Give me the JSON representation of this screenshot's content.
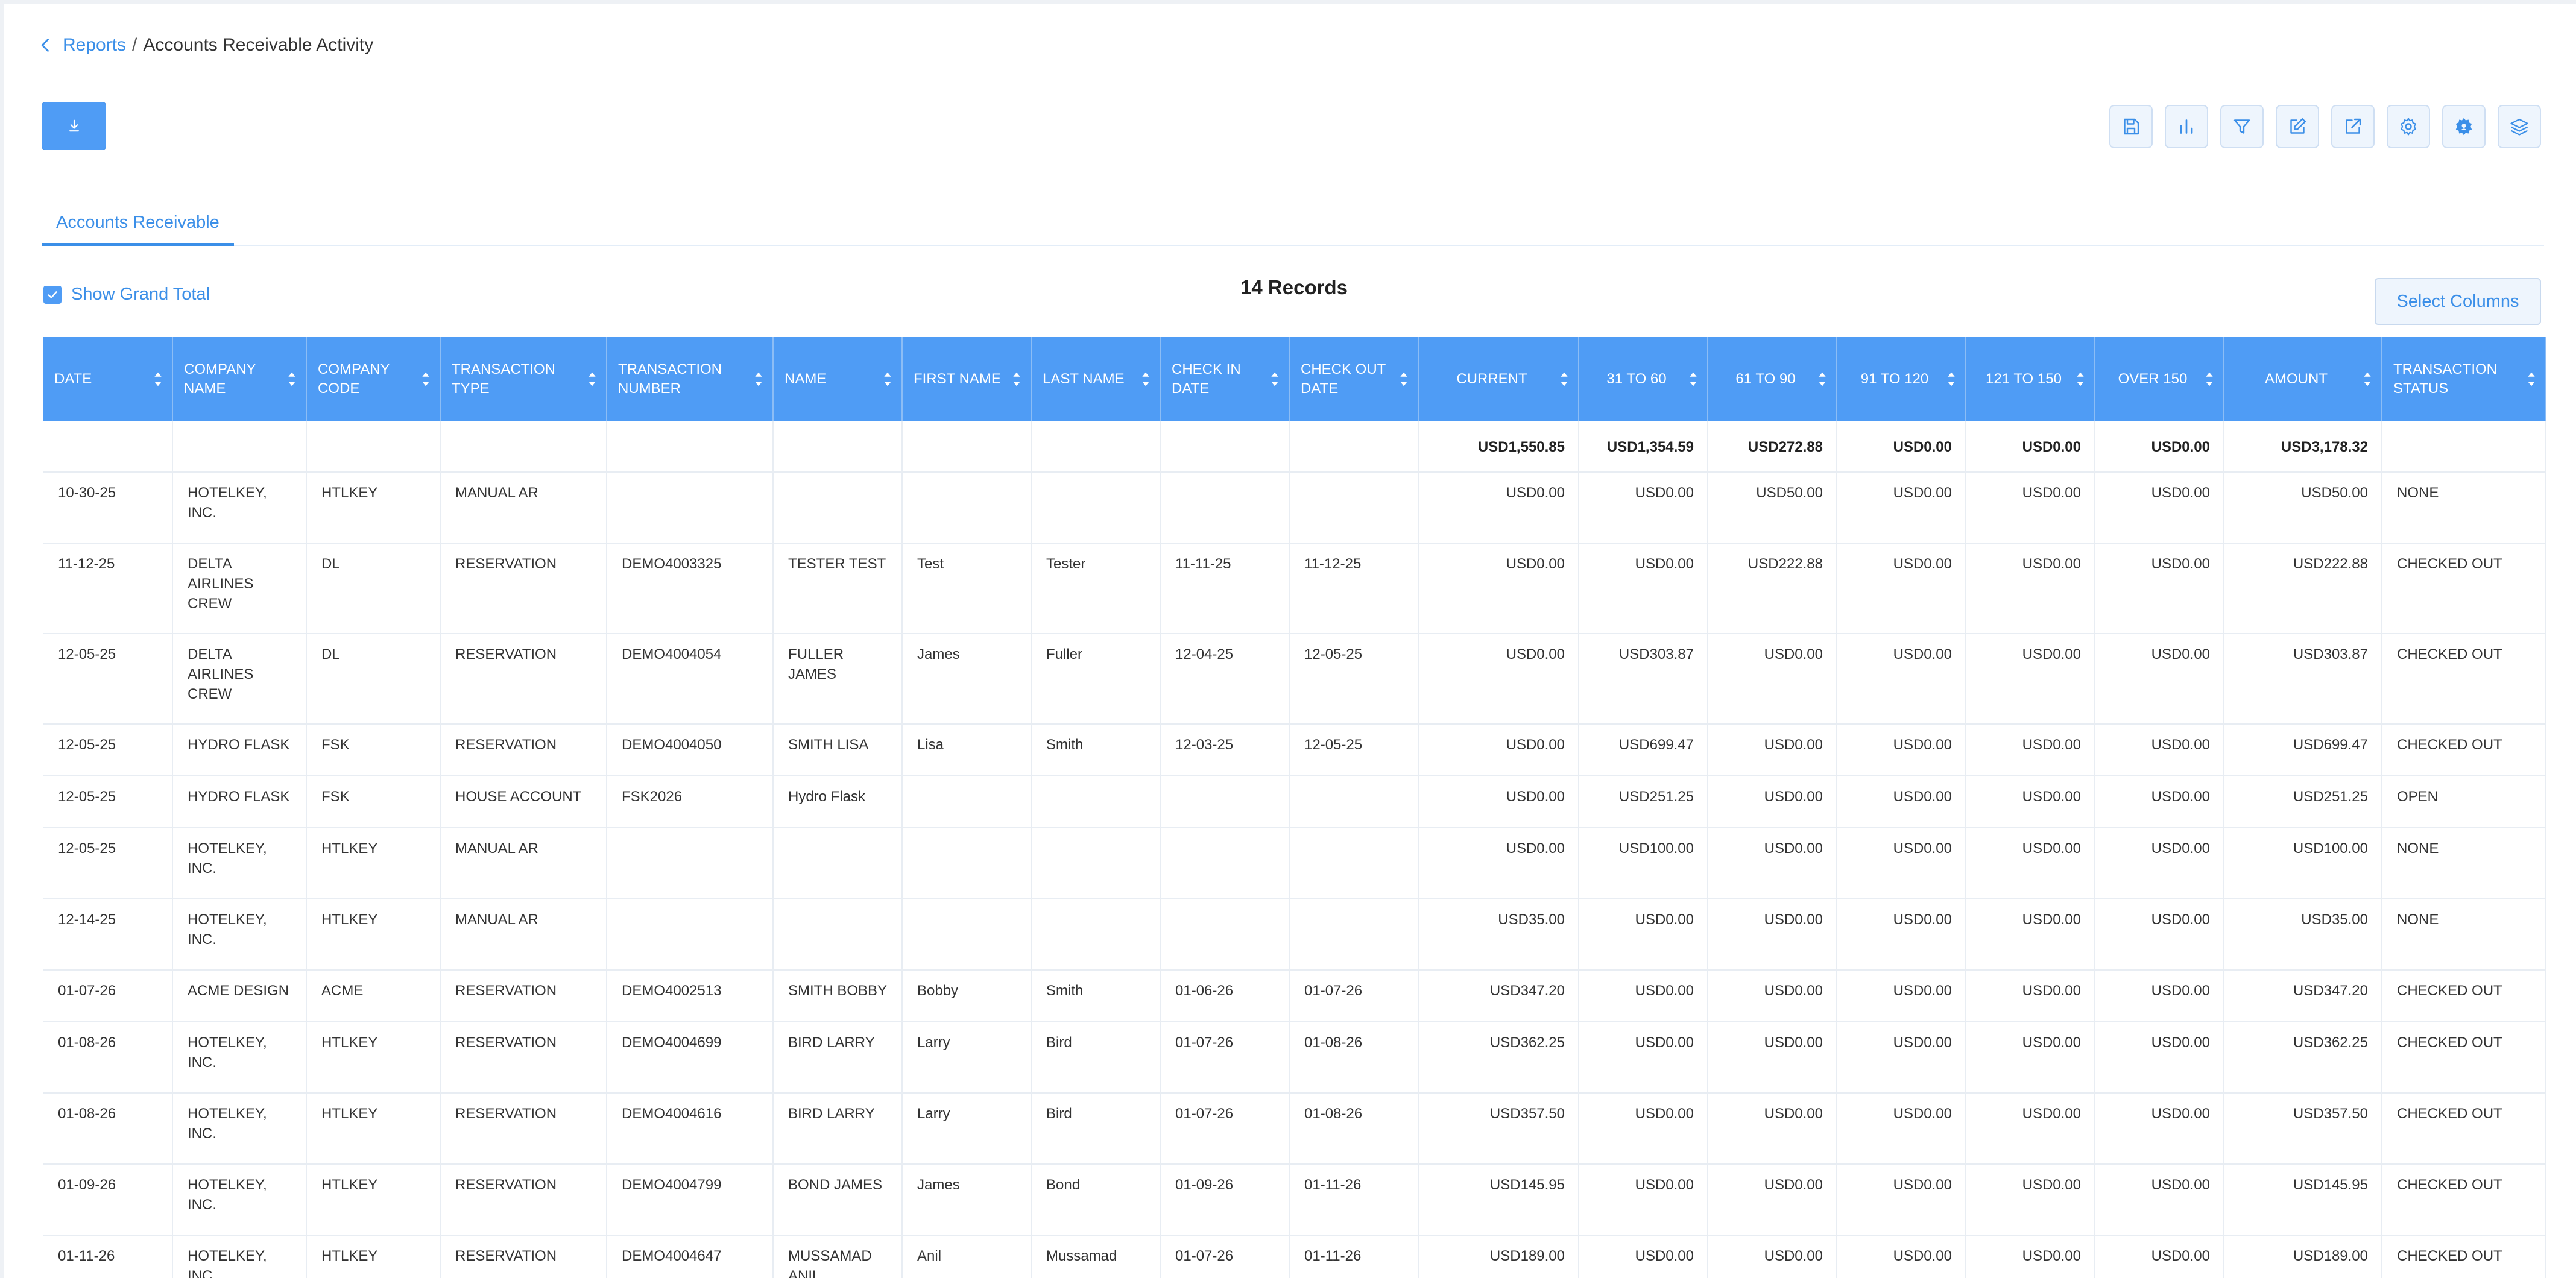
{
  "breadcrumb": {
    "parent": "Reports",
    "separator": "/",
    "current": "Accounts Receivable Activity"
  },
  "tabs": [
    {
      "label": "Accounts Receivable",
      "active": true
    }
  ],
  "grand_total": {
    "label": "Show Grand Total",
    "checked": true
  },
  "records_label": "14 Records",
  "select_columns_label": "Select Columns",
  "toolbar_icons": [
    "save-icon",
    "bar-chart-icon",
    "filter-icon",
    "edit-icon",
    "export-icon",
    "settings-icon",
    "gear-badge-icon",
    "layers-icon"
  ],
  "colors": {
    "accent": "#4f9cf5",
    "link": "#3b8fe8",
    "header_text": "#ffffff"
  },
  "table": {
    "columns": [
      {
        "key": "date",
        "label": "DATE"
      },
      {
        "key": "company_name",
        "label": "COMPANY NAME"
      },
      {
        "key": "company_code",
        "label": "COMPANY CODE"
      },
      {
        "key": "transaction_type",
        "label": "TRANSACTION TYPE"
      },
      {
        "key": "transaction_number",
        "label": "TRANSACTION NUMBER"
      },
      {
        "key": "name",
        "label": "NAME"
      },
      {
        "key": "first_name",
        "label": "FIRST NAME"
      },
      {
        "key": "last_name",
        "label": "LAST NAME"
      },
      {
        "key": "check_in",
        "label": "CHECK IN DATE"
      },
      {
        "key": "check_out",
        "label": "CHECK OUT DATE"
      },
      {
        "key": "current",
        "label": "CURRENT",
        "numeric": true
      },
      {
        "key": "d31_60",
        "label": "31 TO 60",
        "numeric": true
      },
      {
        "key": "d61_90",
        "label": "61 TO 90",
        "numeric": true
      },
      {
        "key": "d91_120",
        "label": "91 TO 120",
        "numeric": true
      },
      {
        "key": "d121_150",
        "label": "121 TO 150",
        "numeric": true
      },
      {
        "key": "over150",
        "label": "OVER 150",
        "numeric": true
      },
      {
        "key": "amount",
        "label": "AMOUNT",
        "numeric": true
      },
      {
        "key": "status",
        "label": "TRANSACTION STATUS"
      }
    ],
    "totals": [
      "",
      "",
      "",
      "",
      "",
      "",
      "",
      "",
      "",
      "",
      "USD1,550.85",
      "USD1,354.59",
      "USD272.88",
      "USD0.00",
      "USD0.00",
      "USD0.00",
      "USD3,178.32",
      ""
    ],
    "rows": [
      [
        "10-30-25",
        "HOTELKEY, INC.",
        "HTLKEY",
        "MANUAL AR",
        "",
        "",
        "",
        "",
        "",
        "",
        "USD0.00",
        "USD0.00",
        "USD50.00",
        "USD0.00",
        "USD0.00",
        "USD0.00",
        "USD50.00",
        "NONE"
      ],
      [
        "11-12-25",
        "DELTA AIRLINES CREW",
        "DL",
        "RESERVATION",
        "DEMO4003325",
        "TESTER TEST",
        "Test",
        "Tester",
        "11-11-25",
        "11-12-25",
        "USD0.00",
        "USD0.00",
        "USD222.88",
        "USD0.00",
        "USD0.00",
        "USD0.00",
        "USD222.88",
        "CHECKED OUT"
      ],
      [
        "12-05-25",
        "DELTA AIRLINES CREW",
        "DL",
        "RESERVATION",
        "DEMO4004054",
        "FULLER JAMES",
        "James",
        "Fuller",
        "12-04-25",
        "12-05-25",
        "USD0.00",
        "USD303.87",
        "USD0.00",
        "USD0.00",
        "USD0.00",
        "USD0.00",
        "USD303.87",
        "CHECKED OUT"
      ],
      [
        "12-05-25",
        "HYDRO FLASK",
        "FSK",
        "RESERVATION",
        "DEMO4004050",
        "SMITH LISA",
        "Lisa",
        "Smith",
        "12-03-25",
        "12-05-25",
        "USD0.00",
        "USD699.47",
        "USD0.00",
        "USD0.00",
        "USD0.00",
        "USD0.00",
        "USD699.47",
        "CHECKED OUT"
      ],
      [
        "12-05-25",
        "HYDRO FLASK",
        "FSK",
        "HOUSE ACCOUNT",
        "FSK2026",
        "Hydro Flask",
        "",
        "",
        "",
        "",
        "USD0.00",
        "USD251.25",
        "USD0.00",
        "USD0.00",
        "USD0.00",
        "USD0.00",
        "USD251.25",
        "OPEN"
      ],
      [
        "12-05-25",
        "HOTELKEY, INC.",
        "HTLKEY",
        "MANUAL AR",
        "",
        "",
        "",
        "",
        "",
        "",
        "USD0.00",
        "USD100.00",
        "USD0.00",
        "USD0.00",
        "USD0.00",
        "USD0.00",
        "USD100.00",
        "NONE"
      ],
      [
        "12-14-25",
        "HOTELKEY, INC.",
        "HTLKEY",
        "MANUAL AR",
        "",
        "",
        "",
        "",
        "",
        "",
        "USD35.00",
        "USD0.00",
        "USD0.00",
        "USD0.00",
        "USD0.00",
        "USD0.00",
        "USD35.00",
        "NONE"
      ],
      [
        "01-07-26",
        "ACME DESIGN",
        "ACME",
        "RESERVATION",
        "DEMO4002513",
        "SMITH BOBBY",
        "Bobby",
        "Smith",
        "01-06-26",
        "01-07-26",
        "USD347.20",
        "USD0.00",
        "USD0.00",
        "USD0.00",
        "USD0.00",
        "USD0.00",
        "USD347.20",
        "CHECKED OUT"
      ],
      [
        "01-08-26",
        "HOTELKEY, INC.",
        "HTLKEY",
        "RESERVATION",
        "DEMO4004699",
        "BIRD LARRY",
        "Larry",
        "Bird",
        "01-07-26",
        "01-08-26",
        "USD362.25",
        "USD0.00",
        "USD0.00",
        "USD0.00",
        "USD0.00",
        "USD0.00",
        "USD362.25",
        "CHECKED OUT"
      ],
      [
        "01-08-26",
        "HOTELKEY, INC.",
        "HTLKEY",
        "RESERVATION",
        "DEMO4004616",
        "BIRD LARRY",
        "Larry",
        "Bird",
        "01-07-26",
        "01-08-26",
        "USD357.50",
        "USD0.00",
        "USD0.00",
        "USD0.00",
        "USD0.00",
        "USD0.00",
        "USD357.50",
        "CHECKED OUT"
      ],
      [
        "01-09-26",
        "HOTELKEY, INC.",
        "HTLKEY",
        "RESERVATION",
        "DEMO4004799",
        "BOND JAMES",
        "James",
        "Bond",
        "01-09-26",
        "01-11-26",
        "USD145.95",
        "USD0.00",
        "USD0.00",
        "USD0.00",
        "USD0.00",
        "USD0.00",
        "USD145.95",
        "CHECKED OUT"
      ],
      [
        "01-11-26",
        "HOTELKEY, INC.",
        "HTLKEY",
        "RESERVATION",
        "DEMO4004647",
        "MUSSAMAD ANIL",
        "Anil",
        "Mussamad",
        "01-07-26",
        "01-11-26",
        "USD189.00",
        "USD0.00",
        "USD0.00",
        "USD0.00",
        "USD0.00",
        "USD0.00",
        "USD189.00",
        "CHECKED OUT"
      ]
    ]
  }
}
